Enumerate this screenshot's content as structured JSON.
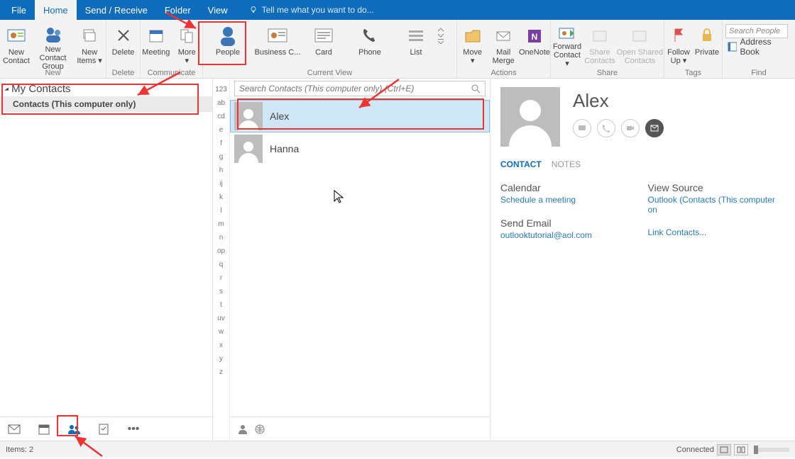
{
  "tabs": {
    "file": "File",
    "home": "Home",
    "sendreceive": "Send / Receive",
    "folder": "Folder",
    "view": "View",
    "tellme": "Tell me what you want to do..."
  },
  "ribbon": {
    "new": {
      "label": "New",
      "newContact": "New\nContact",
      "newGroup": "New Contact\nGroup",
      "newItems": "New\nItems ▾"
    },
    "delete": {
      "label": "Delete",
      "delete": "Delete"
    },
    "communicate": {
      "label": "Communicate",
      "meeting": "Meeting",
      "more": "More\n▾"
    },
    "currentview": {
      "label": "Current View",
      "people": "People",
      "biz": "Business C...",
      "card": "Card",
      "phone": "Phone",
      "list": "List"
    },
    "actions": {
      "label": "Actions",
      "move": "Move\n▾",
      "mailmerge": "Mail\nMerge",
      "onenote": "OneNote"
    },
    "share": {
      "label": "Share",
      "forward": "Forward\nContact ▾",
      "sharec": "Share\nContacts",
      "openshared": "Open Shared\nContacts"
    },
    "tags": {
      "label": "Tags",
      "followup": "Follow\nUp ▾",
      "private": "Private"
    },
    "find": {
      "label": "Find",
      "searchPH": "Search People",
      "addressbook": "Address Book"
    }
  },
  "navpane": {
    "header": "My Contacts",
    "folder": "Contacts (This computer only)"
  },
  "alpha": [
    "123",
    "ab",
    "cd",
    "e",
    "f",
    "g",
    "h",
    "ij",
    "k",
    "l",
    "m",
    "n",
    "op",
    "q",
    "r",
    "s",
    "t",
    "uv",
    "w",
    "x",
    "y",
    "z"
  ],
  "search": {
    "placeholder": "Search Contacts (This computer only) (Ctrl+E)"
  },
  "contacts": [
    {
      "name": "Alex",
      "selected": true
    },
    {
      "name": "Hanna",
      "selected": false
    }
  ],
  "reading": {
    "name": "Alex",
    "tabs": {
      "contact": "CONTACT",
      "notes": "NOTES"
    },
    "calendar": {
      "title": "Calendar",
      "link": "Schedule a meeting"
    },
    "sendemail": {
      "title": "Send Email",
      "link": "outlooktutorial@aol.com"
    },
    "viewsource": {
      "title": "View Source",
      "link": "Outlook (Contacts (This computer on"
    },
    "linkcontacts": "Link Contacts..."
  },
  "statusbar": {
    "items": "Items: 2",
    "connected": "Connected"
  }
}
